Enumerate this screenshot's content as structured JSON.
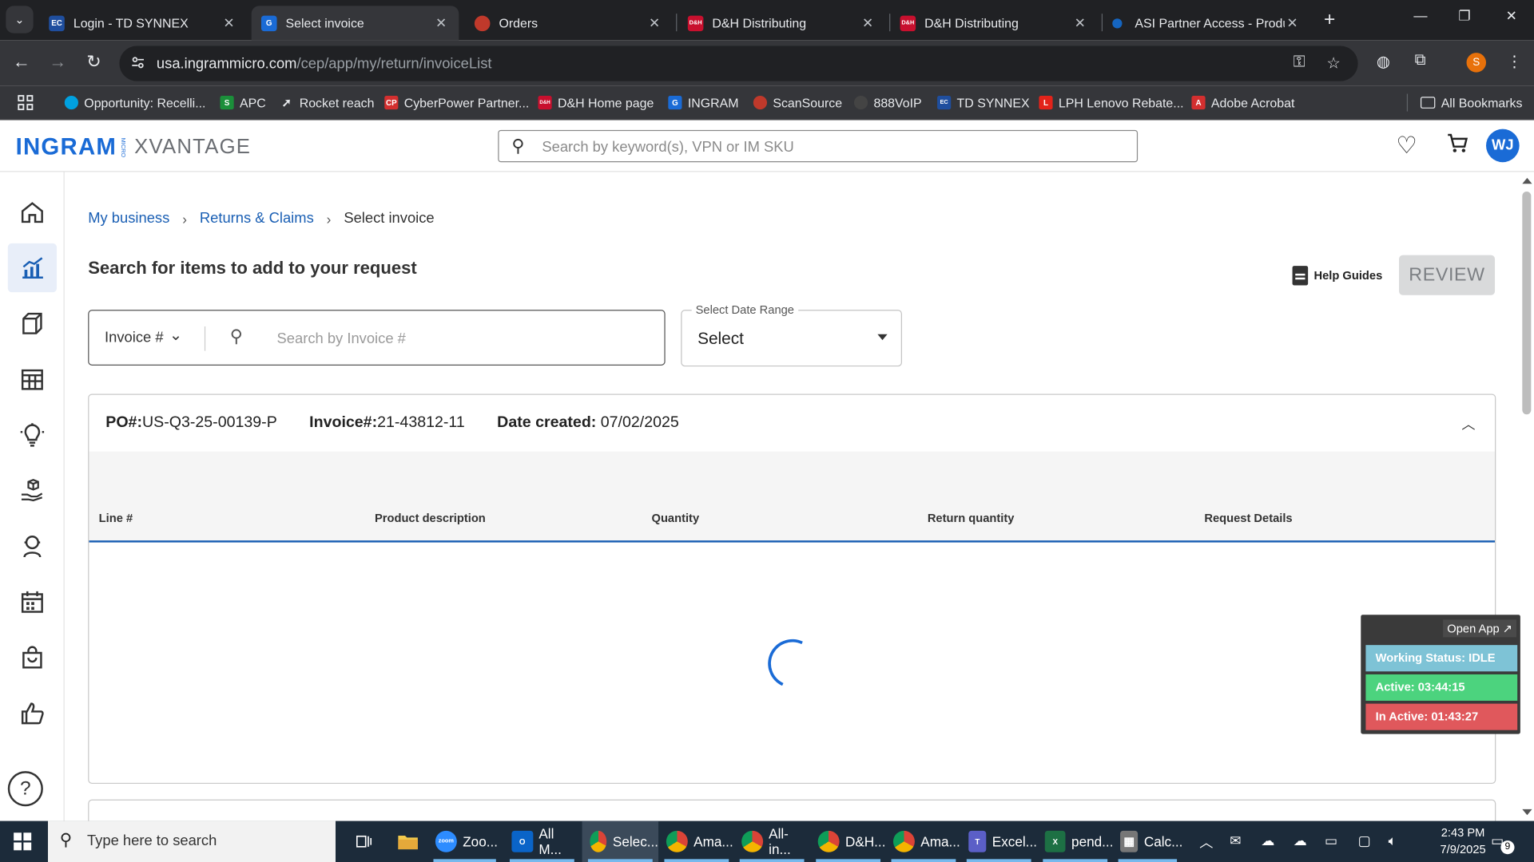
{
  "browser": {
    "tabs": [
      {
        "title": "Login - TD SYNNEX",
        "icon": "ec-icon",
        "fav_text": "EC",
        "color": "#1f4e9e",
        "active": false
      },
      {
        "title": "Select invoice",
        "icon": "ingram-icon",
        "fav_text": "G",
        "color": "#1a6bd6",
        "active": true
      },
      {
        "title": "Orders",
        "icon": "scansource-icon",
        "fav_text": "",
        "color": "#c0392b",
        "active": false
      },
      {
        "title": "D&H Distributing",
        "icon": "dh-icon",
        "fav_text": "D&H",
        "color": "#c8102e",
        "active": false
      },
      {
        "title": "D&H Distributing",
        "icon": "dh-icon",
        "fav_text": "D&H",
        "color": "#c8102e",
        "active": false
      },
      {
        "title": "ASI Partner Access - Produ",
        "icon": "asi-icon",
        "fav_text": "",
        "color": "#1565c0",
        "active": false
      }
    ],
    "url_host": "usa.ingrammicro.com",
    "url_path": "/cep/app/my/return/invoiceList",
    "profile_initial": "S",
    "bookmarks": [
      {
        "label": "Opportunity: Recelli...",
        "icon": "salesforce-icon",
        "color": "#00a1e0",
        "text": ""
      },
      {
        "label": "APC",
        "icon": "apc-icon",
        "color": "#1b8f3a",
        "text": "S"
      },
      {
        "label": "Rocket reach",
        "icon": "rocket-icon",
        "color": "#f7f7f7",
        "text": ""
      },
      {
        "label": "CyberPower Partner...",
        "icon": "cp-icon",
        "color": "#d32f2f",
        "text": "CP"
      },
      {
        "label": "D&H Home page",
        "icon": "dh-icon",
        "color": "#c8102e",
        "text": "D&H"
      },
      {
        "label": "INGRAM",
        "icon": "ingram-icon",
        "color": "#1a6bd6",
        "text": "G"
      },
      {
        "label": "ScanSource",
        "icon": "scansource-icon",
        "color": "#c0392b",
        "text": ""
      },
      {
        "label": "888VoIP",
        "icon": "voip-icon",
        "color": "#444",
        "text": ""
      },
      {
        "label": "TD SYNNEX",
        "icon": "ec-icon",
        "color": "#1f4e9e",
        "text": "EC"
      },
      {
        "label": "LPH Lenovo Rebate...",
        "icon": "lenovo-icon",
        "color": "#e2231a",
        "text": "L"
      },
      {
        "label": "Adobe Acrobat",
        "icon": "acrobat-icon",
        "color": "#d32f2f",
        "text": "A"
      }
    ],
    "all_bookmarks": "All Bookmarks"
  },
  "header": {
    "logo_brand": "INGRAM",
    "logo_micro": "MICRO",
    "logo_product": "XVANTAGE",
    "search_placeholder": "Search by keyword(s), VPN or IM SKU",
    "avatar_initials": "WJ"
  },
  "breadcrumb": [
    "My business",
    "Returns & Claims",
    "Select invoice"
  ],
  "page_title": "Search for items to add to your request",
  "help_guides": "Help Guides",
  "review_button": "REVIEW",
  "invoice_search": {
    "type_selected": "Invoice #",
    "placeholder": "Search by Invoice #"
  },
  "date_range": {
    "label": "Select Date Range",
    "value": "Select"
  },
  "invoice_card": {
    "po_label": "PO#:",
    "po_value": "US-Q3-25-00139-P",
    "invoice_label": "Invoice#:",
    "invoice_value": "21-43812-11",
    "date_label": "Date created:",
    "date_value": "07/02/2025",
    "columns": [
      "Line #",
      "Product description",
      "Quantity",
      "Return quantity",
      "Request Details"
    ]
  },
  "status_widget": {
    "open_app": "Open App ↗",
    "working_status": "Working Status: IDLE",
    "active": "Active: 03:44:15",
    "inactive": "In Active: 01:43:27",
    "colors": {
      "idle": "#7ec3d6",
      "active": "#4cd37e",
      "inactive": "#e0585c"
    }
  },
  "taskbar": {
    "search_text": "Type here to search",
    "apps": [
      {
        "label": "Zoo...",
        "icon": "zoom-icon",
        "color": "#2d8cff",
        "text": "zoom"
      },
      {
        "label": "All M...",
        "icon": "outlook-icon",
        "color": "#0a64c8",
        "text": "O"
      },
      {
        "label": "Selec...",
        "icon": "chrome-icon",
        "color": "#db4437",
        "text": "",
        "active": true
      },
      {
        "label": "Ama...",
        "icon": "chrome-icon",
        "color": "#db4437",
        "text": ""
      },
      {
        "label": "All-in...",
        "icon": "chrome-icon",
        "color": "#db4437",
        "text": ""
      },
      {
        "label": "D&H...",
        "icon": "chrome-icon",
        "color": "#db4437",
        "text": ""
      },
      {
        "label": "Ama...",
        "icon": "chrome-icon",
        "color": "#db4437",
        "text": ""
      },
      {
        "label": "Excel...",
        "icon": "teams-icon",
        "color": "#5b5fc7",
        "text": "T"
      },
      {
        "label": "pend...",
        "icon": "excel-icon",
        "color": "#1d7044",
        "text": "X"
      },
      {
        "label": "Calc...",
        "icon": "calculator-icon",
        "color": "#777",
        "text": "▦"
      }
    ],
    "time": "2:43 PM",
    "date": "7/9/2025",
    "notifications": "9"
  }
}
